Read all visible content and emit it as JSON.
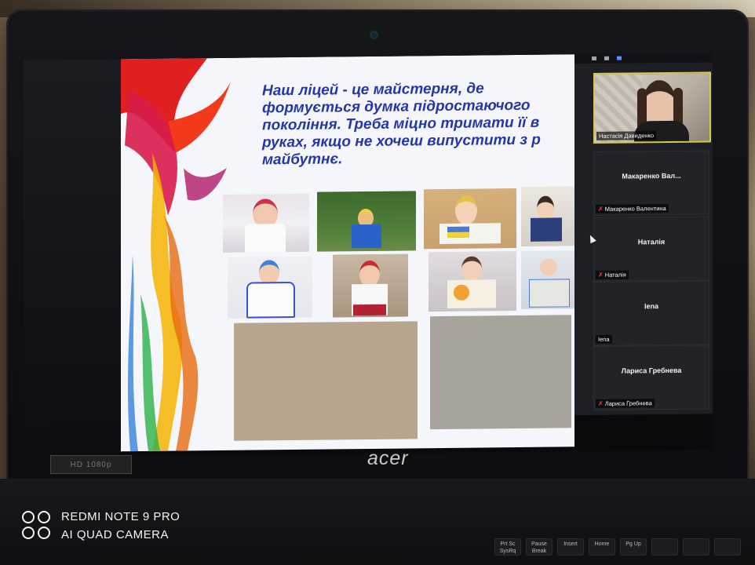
{
  "slide": {
    "text": "Наш ліцей - це майстерня, де\nформується думка підростаючого\nпокоління. Треба міцно тримати її в\nруках, якщо не хочеш випустити з р\nмайбутнє."
  },
  "gallery": {
    "participants": [
      {
        "title": "",
        "label": "Настасія Давиденко",
        "muted": false,
        "video": true
      },
      {
        "title": "Макаренко Вал...",
        "label": "Макаренко Валентина",
        "muted": true,
        "video": false
      },
      {
        "title": "Наталія",
        "label": "Наталія",
        "muted": true,
        "video": false
      },
      {
        "title": "Iena",
        "label": "Iena",
        "muted": false,
        "video": false
      },
      {
        "title": "Лариса Гребнева",
        "label": "Лариса Гребнева",
        "muted": true,
        "video": false
      }
    ]
  },
  "laptop": {
    "brand": "acer",
    "sticker": "HD 1080p"
  },
  "keyboard": {
    "keys": [
      "Prt Sc SysRq",
      "Pause Break",
      "Insert",
      "Home",
      "Pg Up",
      "",
      "",
      "",
      ""
    ]
  },
  "watermark": {
    "line1": "REDMI NOTE 9 PRO",
    "line2": "AI QUAD CAMERA"
  },
  "colors": {
    "slide_text": "#2536a8",
    "active_speaker_border": "#d9c94a",
    "muted_mic": "#e04848"
  }
}
